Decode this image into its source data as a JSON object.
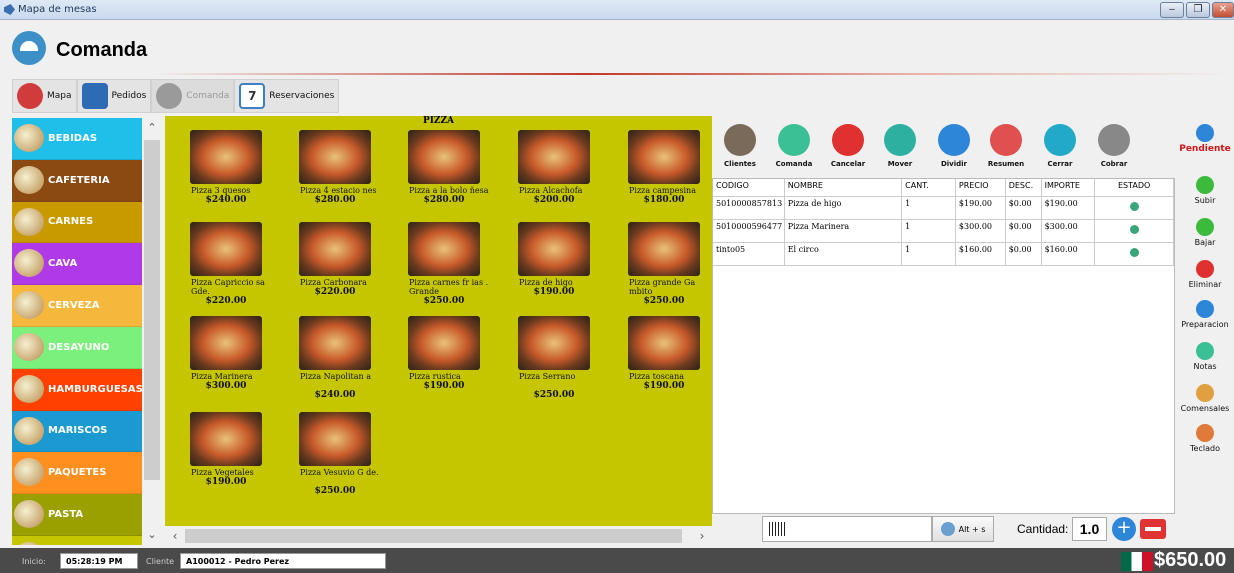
{
  "window": {
    "title": "Mapa de mesas"
  },
  "header": {
    "title": "Comanda"
  },
  "tabs": [
    {
      "label": "Mapa",
      "icon": "location-pin-icon",
      "color": "#d23b3b"
    },
    {
      "label": "Pedidos",
      "icon": "delivery-icon",
      "color": "#2e6bb5"
    },
    {
      "label": "Comanda",
      "icon": "cloche-icon",
      "color": "#9a9a9a"
    },
    {
      "label": "Reservaciones",
      "icon": "calendar-icon",
      "color": "#3d7fc2",
      "calendar_day": "7"
    }
  ],
  "categories": [
    {
      "label": "BEBIDAS",
      "color": "#1fbfea"
    },
    {
      "label": "CAFETERIA",
      "color": "#8b4a12"
    },
    {
      "label": "CARNES",
      "color": "#c99a00"
    },
    {
      "label": "CAVA",
      "color": "#b13ae8"
    },
    {
      "label": "CERVEZA",
      "color": "#f5b83d"
    },
    {
      "label": "DESAYUNO",
      "color": "#7cf07c"
    },
    {
      "label": "HAMBURGUESAS",
      "color": "#ff4000"
    },
    {
      "label": "MARISCOS",
      "color": "#1a9ad0"
    },
    {
      "label": "PAQUETES",
      "color": "#ff9020"
    },
    {
      "label": "PASTA",
      "color": "#9aa000"
    },
    {
      "label": "PIZZA",
      "color": "#c6c600"
    }
  ],
  "category_title": "PIZZA",
  "products": [
    {
      "name": "Pizza 3 quesos",
      "price": "$240.00"
    },
    {
      "name": "Pizza 4 estacio nes",
      "price": "$280.00"
    },
    {
      "name": "Pizza a la bolo ñesa",
      "price": "$280.00"
    },
    {
      "name": "Pizza Alcachofa",
      "price": "$200.00"
    },
    {
      "name": "Pizza campesina",
      "price": "$180.00"
    },
    {
      "name": "Pizza Capriccio sa Gde.",
      "price": "$220.00"
    },
    {
      "name": "Pizza Carbonara",
      "price": "$220.00"
    },
    {
      "name": "Pizza carnes fr ias . Grande",
      "price": "$250.00"
    },
    {
      "name": "Pizza de higo",
      "price": "$190.00"
    },
    {
      "name": "Pizza grande Ga mbito",
      "price": "$250.00"
    },
    {
      "name": "Pizza Marinera",
      "price": "$300.00"
    },
    {
      "name": "Pizza Napolitan a",
      "price": "$240.00"
    },
    {
      "name": "Pizza rustica",
      "price": "$190.00"
    },
    {
      "name": "Pizza Serrano",
      "price": "$250.00"
    },
    {
      "name": "Pizza toscana",
      "price": "$190.00"
    },
    {
      "name": "Pizza Vegetales",
      "price": "$190.00"
    },
    {
      "name": "Pizza Vesuvio G de.",
      "price": "$250.00"
    }
  ],
  "actions": [
    {
      "label": "Clientes",
      "icon": "person-icon",
      "color": "#7a6a5a"
    },
    {
      "label": "Comanda",
      "icon": "send-icon",
      "color": "#3bbf94"
    },
    {
      "label": "Cancelar",
      "icon": "cancel-icon",
      "color": "#e03030"
    },
    {
      "label": "Mover",
      "icon": "move-icon",
      "color": "#2eb0a0"
    },
    {
      "label": "Dividir",
      "icon": "percent-icon",
      "color": "#2e86d9"
    },
    {
      "label": "Resumen",
      "icon": "receipt-icon",
      "color": "#e05050"
    },
    {
      "label": "Cerrar",
      "icon": "cash-icon",
      "color": "#22a8c8"
    },
    {
      "label": "Cobrar",
      "icon": "money-bag-icon",
      "color": "#888888"
    }
  ],
  "order_table": {
    "headers": [
      "CODIGO",
      "NOMBRE",
      "CANT.",
      "PRECIO",
      "DESC.",
      "IMPORTE",
      "ESTADO"
    ],
    "rows": [
      {
        "codigo": "5010000857813",
        "nombre": "Pizza de higo",
        "cant": "1",
        "precio": "$190.00",
        "desc": "$0.00",
        "importe": "$190.00"
      },
      {
        "codigo": "5010000596477",
        "nombre": "Pizza Marinera",
        "cant": "1",
        "precio": "$300.00",
        "desc": "$0.00",
        "importe": "$300.00"
      },
      {
        "codigo": "tinto05",
        "nombre": "El circo",
        "cant": "1",
        "precio": "$160.00",
        "desc": "$0.00",
        "importe": "$160.00"
      }
    ]
  },
  "barcode": {
    "shortcut": "Alt + s"
  },
  "quantity": {
    "label": "Cantidad:",
    "value": "1.0"
  },
  "right_actions": [
    {
      "label": "Pendiente",
      "icon": "hourglass-icon",
      "color": "#2e86d9"
    },
    {
      "label": "Subir",
      "icon": "arrow-up-icon",
      "color": "#3cba3c"
    },
    {
      "label": "Bajar",
      "icon": "arrow-down-icon",
      "color": "#3cba3c"
    },
    {
      "label": "Eliminar",
      "icon": "delete-icon",
      "color": "#e03030"
    },
    {
      "label": "Preparacion",
      "icon": "chef-icon",
      "color": "#2e86d9"
    },
    {
      "label": "Notas",
      "icon": "pencil-icon",
      "color": "#3bbf94"
    },
    {
      "label": "Comensales",
      "icon": "people-icon",
      "color": "#e0a040"
    },
    {
      "label": "Teclado",
      "icon": "keyboard-icon",
      "color": "#e07a3a"
    }
  ],
  "status": {
    "inicio_label": "Inicio:",
    "time": "05:28:19 PM",
    "cliente_label": "Cliente",
    "cliente": "A100012 - Pedro Perez",
    "total": "$650.00"
  }
}
